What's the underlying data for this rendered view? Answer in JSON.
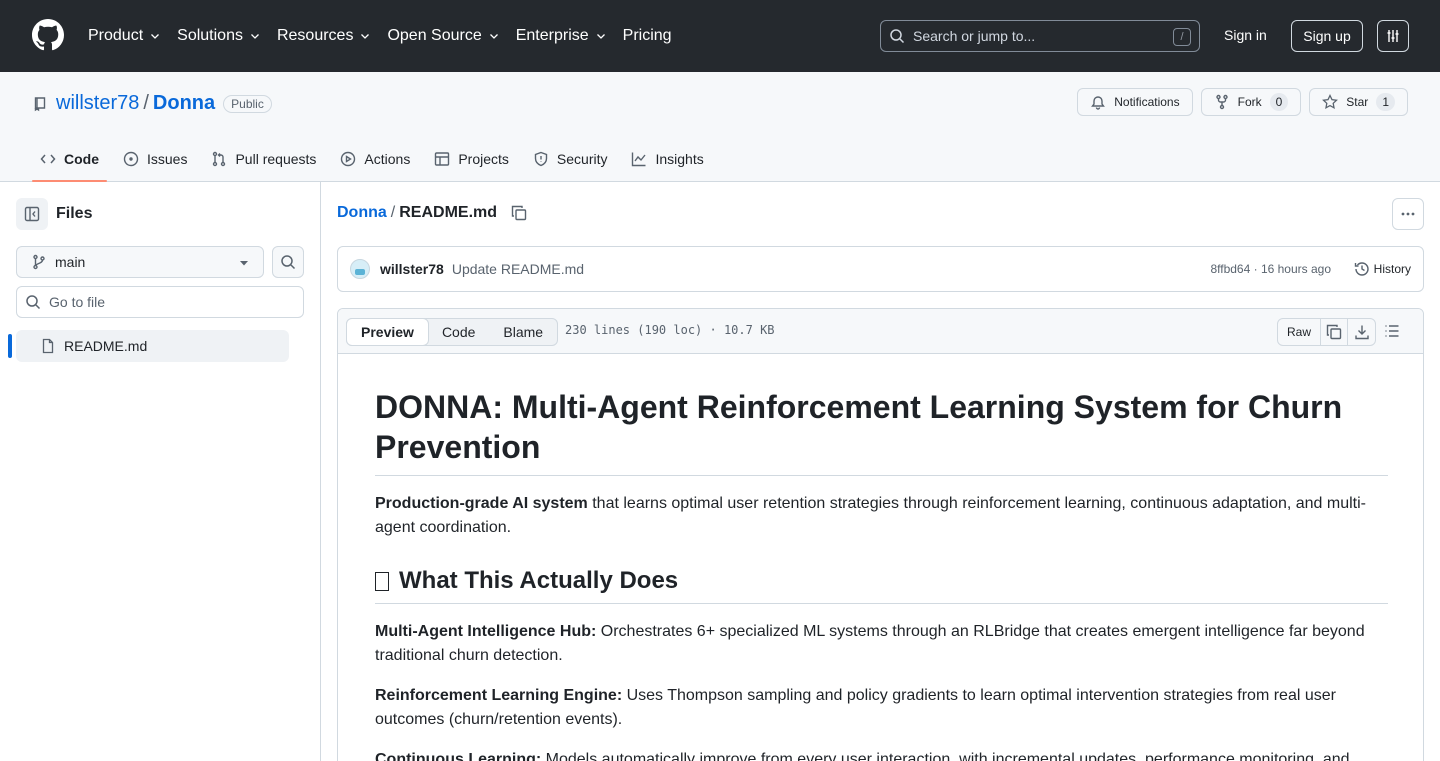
{
  "topnav": {
    "items": [
      "Product",
      "Solutions",
      "Resources",
      "Open Source",
      "Enterprise",
      "Pricing"
    ],
    "search_placeholder": "Search or jump to...",
    "search_shortcut": "/",
    "signin": "Sign in",
    "signup": "Sign up"
  },
  "repo": {
    "owner": "willster78",
    "separator": "/",
    "name": "Donna",
    "visibility": "Public",
    "notifications": "Notifications",
    "fork_label": "Fork",
    "fork_count": "0",
    "star_label": "Star",
    "star_count": "1",
    "tabs": [
      "Code",
      "Issues",
      "Pull requests",
      "Actions",
      "Projects",
      "Security",
      "Insights"
    ]
  },
  "sidebar": {
    "title": "Files",
    "branch": "main",
    "goto_placeholder": "Go to file",
    "files": [
      "README.md"
    ]
  },
  "breadcrumb": {
    "repo": "Donna",
    "separator": "/",
    "file": "README.md"
  },
  "commit": {
    "author": "willster78",
    "message": "Update README.md",
    "meta": "8ffbd64 · 16 hours ago",
    "history": "History"
  },
  "filebar": {
    "tabs": [
      "Preview",
      "Code",
      "Blame"
    ],
    "info": "230 lines (190 loc) · 10.7 KB",
    "raw": "Raw"
  },
  "readme": {
    "h1": "DONNA: Multi-Agent Reinforcement Learning System for Churn Prevention",
    "intro_bold": "Production-grade AI system",
    "intro_rest": " that learns optimal user retention strategies through reinforcement learning, continuous adaptation, and multi-agent coordination.",
    "h2": "What This Actually Does",
    "p1_bold": "Multi-Agent Intelligence Hub:",
    "p1_rest": " Orchestrates 6+ specialized ML systems through an RLBridge that creates emergent intelligence far beyond traditional churn detection.",
    "p2_bold": "Reinforcement Learning Engine:",
    "p2_rest": " Uses Thompson sampling and policy gradients to learn optimal intervention strategies from real user outcomes (churn/retention events).",
    "p3_bold": "Continuous Learning:",
    "p3_rest": " Models automatically improve from every user interaction, with incremental updates, performance monitoring, and"
  }
}
